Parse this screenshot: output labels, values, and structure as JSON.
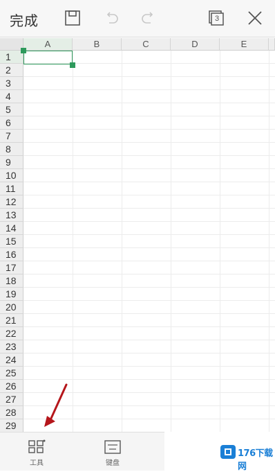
{
  "toolbar": {
    "done_label": "完成",
    "sheet_count": "3"
  },
  "sheet": {
    "columns": [
      "A",
      "B",
      "C",
      "D",
      "E"
    ],
    "rows": [
      "1",
      "2",
      "3",
      "4",
      "5",
      "6",
      "7",
      "8",
      "9",
      "10",
      "11",
      "12",
      "13",
      "14",
      "15",
      "16",
      "17",
      "18",
      "19",
      "20",
      "21",
      "22",
      "23",
      "24",
      "25",
      "26",
      "27",
      "28",
      "29"
    ],
    "selected_cell": "A1",
    "accent_color": "#2e9a5c"
  },
  "bottom": {
    "tools_label": "工具",
    "keyboard_label": "键盘"
  },
  "watermark": {
    "text": "176下载网"
  },
  "icons": {
    "save": "save-icon",
    "undo": "undo-icon",
    "redo": "redo-icon",
    "sheets": "sheets-icon",
    "close": "close-icon",
    "tools": "tools-grid-icon",
    "keyboard": "keyboard-icon"
  }
}
